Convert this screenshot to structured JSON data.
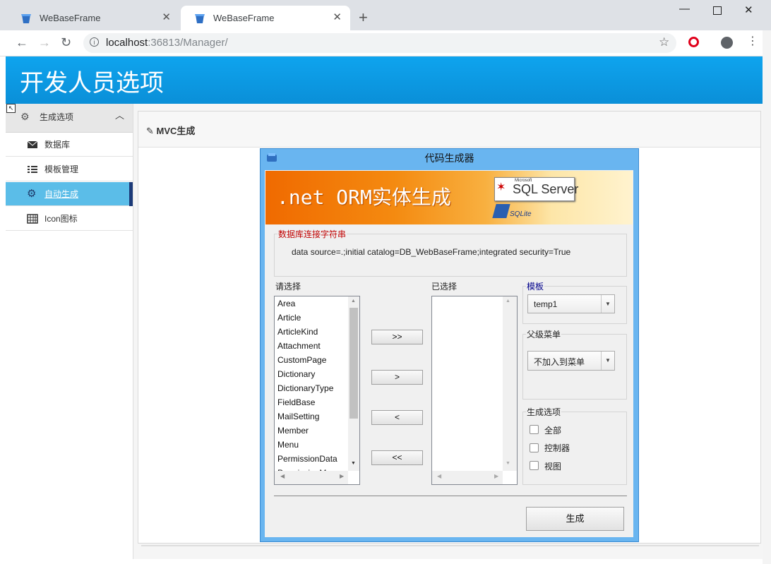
{
  "browser": {
    "tabs": [
      {
        "title": "WeBaseFrame",
        "active": false
      },
      {
        "title": "WeBaseFrame",
        "active": true
      }
    ],
    "url_host": "localhost",
    "url_path": ":36813/Manager/",
    "icons": {
      "back": "back-arrow-icon",
      "forward": "forward-arrow-icon",
      "reload": "reload-icon",
      "info": "info-icon",
      "star": "star-icon",
      "opera": "opera-icon",
      "account": "account-icon",
      "menu": "menu-dots-icon"
    }
  },
  "app": {
    "title": "开发人员选项",
    "sidebar": {
      "group_label": "生成选项",
      "items": [
        {
          "label": "数据库",
          "icon": "envelope-icon",
          "active": false
        },
        {
          "label": "模板管理",
          "icon": "list-icon",
          "active": false
        },
        {
          "label": "自动生成",
          "icon": "gear-icon",
          "active": true
        },
        {
          "label": "Icon图标",
          "icon": "grid-icon",
          "active": false
        }
      ]
    },
    "panel_title": "MVC生成"
  },
  "dialog": {
    "title": "代码生成器",
    "banner_text": ".net ORM实体生成",
    "banner_logo_small": "Microsoft",
    "banner_logo": "SQL Server",
    "banner_logo2": "SQLite",
    "conn_label": "数据库连接字符串",
    "conn_string": "data source=.;initial catalog=DB_WebBaseFrame;integrated security=True",
    "available_label": "请选择",
    "available_items": [
      "Area",
      "Article",
      "ArticleKind",
      "Attachment",
      "CustomPage",
      "Dictionary",
      "DictionaryType",
      "FieldBase",
      "MailSetting",
      "Member",
      "Menu",
      "PermissionData",
      "PermissionMenu"
    ],
    "selected_label": "已选择",
    "buttons": {
      "add_all": ">>",
      "add": ">",
      "remove": "<",
      "remove_all": "<<"
    },
    "template_label": "模板",
    "template_value": "temp1",
    "parent_menu_label": "父级菜单",
    "parent_menu_value": "不加入到菜单",
    "options_label": "生成选项",
    "options": [
      {
        "label": "全部",
        "checked": false
      },
      {
        "label": "控制器",
        "checked": false
      },
      {
        "label": "视图",
        "checked": false
      }
    ],
    "generate_label": "生成"
  },
  "colors": {
    "header_blue": "#0a98e2",
    "active_item": "#5bbde8",
    "dialog_border": "#69b5f0",
    "legend_red": "#c00000",
    "legend_blue": "#00008b"
  }
}
